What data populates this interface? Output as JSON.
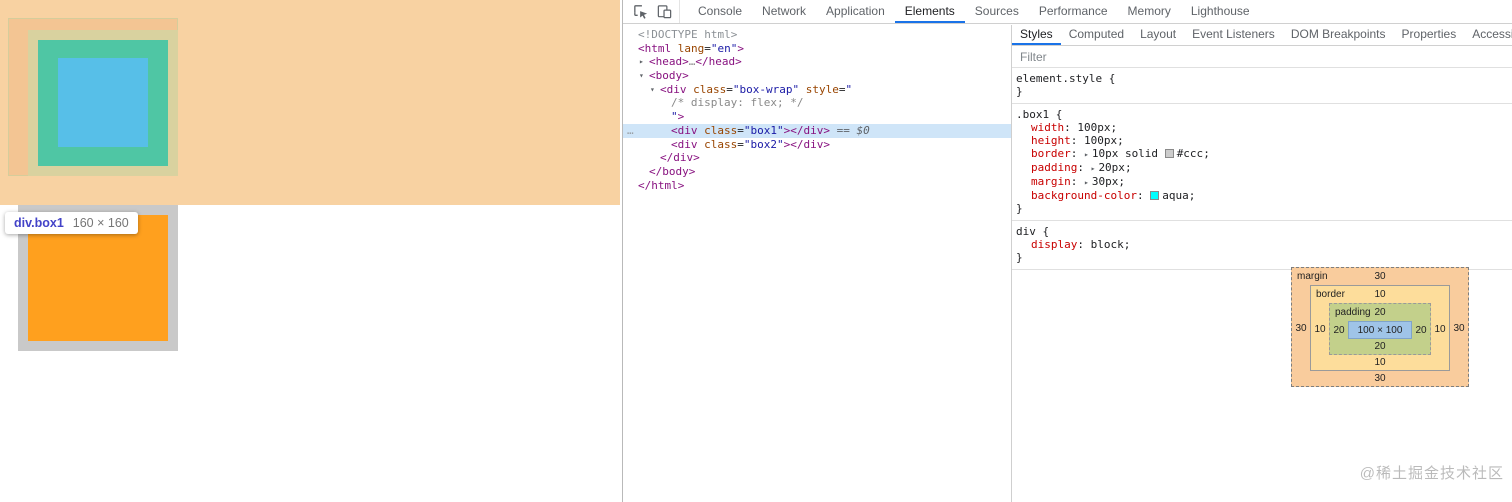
{
  "page": {
    "tooltip": {
      "selector": "div.box1",
      "dims": "160 × 160"
    },
    "colors": {
      "page_background": "#f8d2a2",
      "overlay_content_blue": "#57bfe8",
      "overlay_padding_green": "#4fc6a4",
      "overlay_border_tan": "#d9d29f",
      "box2_fill_orange": "#ffa01e",
      "box2_border_gray": "#c9c9c9"
    }
  },
  "devtools": {
    "icons": {
      "inspect": "inspect-icon",
      "device": "device-toolbar-icon"
    },
    "main_tabs": [
      "Console",
      "Network",
      "Application",
      "Elements",
      "Sources",
      "Performance",
      "Memory",
      "Lighthouse"
    ],
    "main_tabs_selected": "Elements",
    "tree": {
      "lines": [
        {
          "indent": 0,
          "tokens": [
            {
              "c": "doctype",
              "s": "<!DOCTYPE html>"
            }
          ]
        },
        {
          "indent": 0,
          "tokens": [
            {
              "c": "tag",
              "s": "<html"
            },
            {
              "c": "attr",
              "s": " lang"
            },
            {
              "c": "plain",
              "s": "="
            },
            {
              "c": "val",
              "s": "\"en\""
            },
            {
              "c": "tag",
              "s": ">"
            }
          ]
        },
        {
          "indent": 1,
          "arrow": "right",
          "tokens": [
            {
              "c": "tag",
              "s": "<head>"
            },
            {
              "c": "ell",
              "s": "…"
            },
            {
              "c": "tag",
              "s": "</head>"
            }
          ]
        },
        {
          "indent": 1,
          "arrow": "down",
          "tokens": [
            {
              "c": "tag",
              "s": "<body>"
            }
          ]
        },
        {
          "indent": 2,
          "arrow": "down",
          "tokens": [
            {
              "c": "tag",
              "s": "<div"
            },
            {
              "c": "attr",
              "s": " class"
            },
            {
              "c": "plain",
              "s": "="
            },
            {
              "c": "val",
              "s": "\"box-wrap\""
            },
            {
              "c": "attr",
              "s": " style"
            },
            {
              "c": "plain",
              "s": "="
            },
            {
              "c": "val",
              "s": "\""
            }
          ]
        },
        {
          "indent": 3,
          "tokens": [
            {
              "c": "comment",
              "s": "/* display: flex; */"
            }
          ]
        },
        {
          "indent": 3,
          "tokens": [
            {
              "c": "val",
              "s": "\""
            },
            {
              "c": "tag",
              "s": ">"
            }
          ]
        },
        {
          "indent": 3,
          "selected": true,
          "gutter": "…",
          "tokens": [
            {
              "c": "tag",
              "s": "<div"
            },
            {
              "c": "attr",
              "s": " class"
            },
            {
              "c": "plain",
              "s": "="
            },
            {
              "c": "val",
              "s": "\"box1\""
            },
            {
              "c": "tag",
              "s": "></div>"
            },
            {
              "c": "meta",
              "s": " == $0"
            }
          ]
        },
        {
          "indent": 3,
          "tokens": [
            {
              "c": "tag",
              "s": "<div"
            },
            {
              "c": "attr",
              "s": " class"
            },
            {
              "c": "plain",
              "s": "="
            },
            {
              "c": "val",
              "s": "\"box2\""
            },
            {
              "c": "tag",
              "s": "></div>"
            }
          ]
        },
        {
          "indent": 2,
          "tokens": [
            {
              "c": "tag",
              "s": "</div>"
            }
          ]
        },
        {
          "indent": 1,
          "tokens": [
            {
              "c": "tag",
              "s": "</body>"
            }
          ]
        },
        {
          "indent": 0,
          "tokens": [
            {
              "c": "tag",
              "s": "</html>"
            }
          ]
        }
      ]
    },
    "styles": {
      "tabs": [
        "Styles",
        "Computed",
        "Layout",
        "Event Listeners",
        "DOM Breakpoints",
        "Properties",
        "Accessibility"
      ],
      "tabs_selected": "Styles",
      "filter_placeholder": "Filter",
      "rules": [
        {
          "selector": "element.style",
          "props": []
        },
        {
          "selector": ".box1",
          "props": [
            {
              "name": "width",
              "parts": [
                {
                  "t": "text",
                  "s": "100px"
                }
              ]
            },
            {
              "name": "height",
              "parts": [
                {
                  "t": "text",
                  "s": "100px"
                }
              ]
            },
            {
              "name": "border",
              "parts": [
                {
                  "t": "arrow"
                },
                {
                  "t": "text",
                  "s": "10px solid "
                },
                {
                  "t": "swatch",
                  "c": "#cccccc"
                },
                {
                  "t": "text",
                  "s": "#ccc"
                }
              ]
            },
            {
              "name": "padding",
              "parts": [
                {
                  "t": "arrow"
                },
                {
                  "t": "text",
                  "s": "20px"
                }
              ]
            },
            {
              "name": "margin",
              "parts": [
                {
                  "t": "arrow"
                },
                {
                  "t": "text",
                  "s": "30px"
                }
              ]
            },
            {
              "name": "background-color",
              "parts": [
                {
                  "t": "swatch",
                  "c": "#00ffff"
                },
                {
                  "t": "text",
                  "s": "aqua"
                }
              ]
            }
          ]
        },
        {
          "selector": "div",
          "props": [
            {
              "name": "display",
              "parts": [
                {
                  "t": "text",
                  "s": "block"
                }
              ]
            }
          ]
        }
      ],
      "box_model": {
        "margin_label": "margin",
        "margin_top": "30",
        "margin_right": "30",
        "margin_bottom": "30",
        "margin_left": "30",
        "border_label": "border",
        "border_top": "10",
        "border_right": "10",
        "border_bottom": "10",
        "border_left": "10",
        "padding_label": "padding",
        "padding_top": "20",
        "padding_right": "20",
        "padding_bottom": "20",
        "padding_left": "20",
        "content": "100 × 100"
      }
    }
  },
  "watermark": "@稀土掘金技术社区"
}
